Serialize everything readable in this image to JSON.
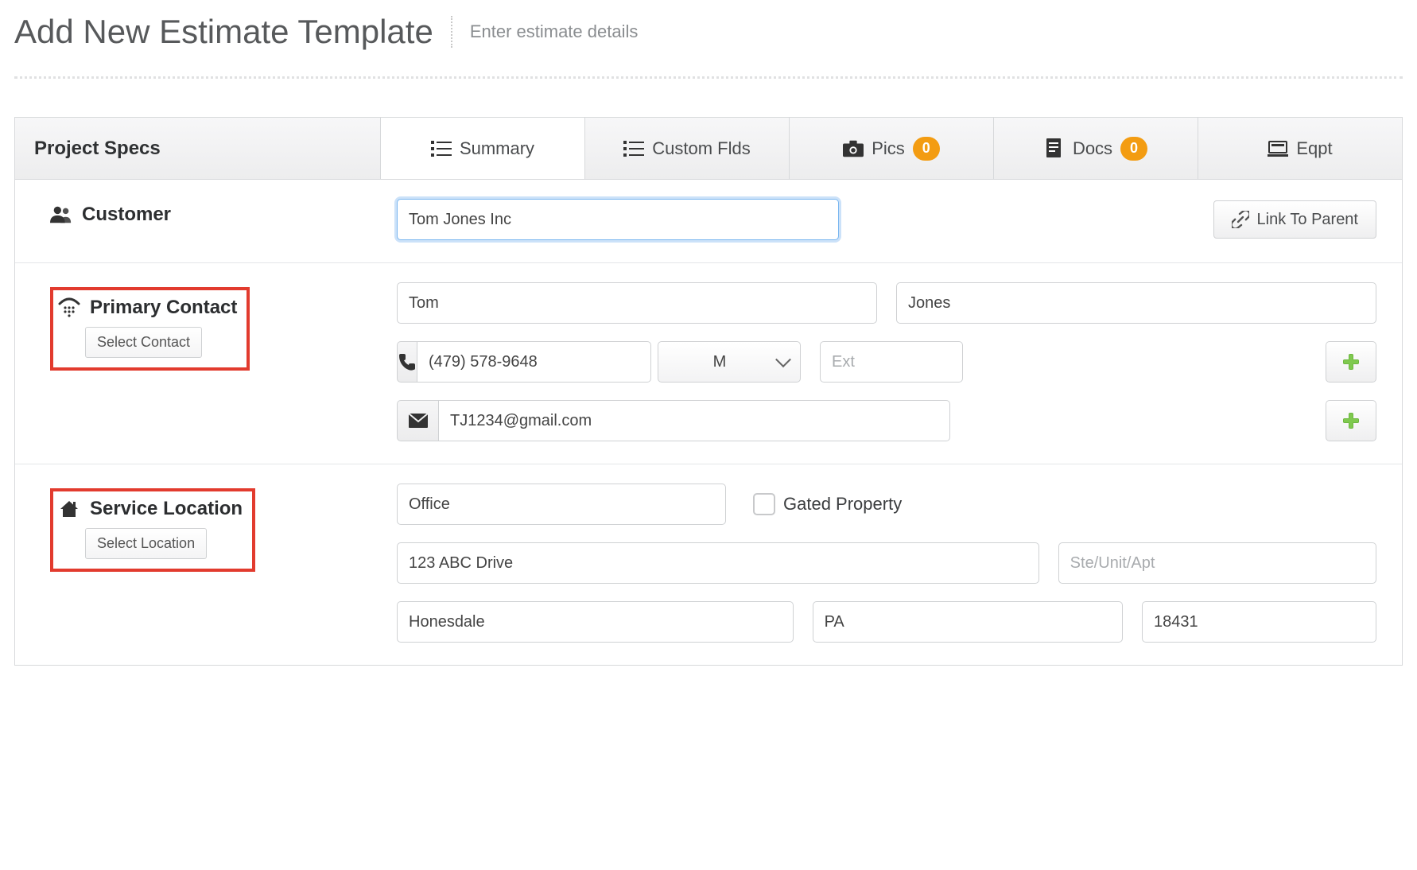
{
  "header": {
    "title": "Add New Estimate Template",
    "subtitle": "Enter estimate details"
  },
  "panel": {
    "section_title": "Project Specs",
    "tabs": {
      "summary": "Summary",
      "custom_flds": "Custom Flds",
      "pics": "Pics",
      "pics_count": "0",
      "docs": "Docs",
      "docs_count": "0",
      "eqpt": "Eqpt"
    }
  },
  "customer": {
    "label": "Customer",
    "value": "Tom Jones Inc",
    "link_parent": "Link To Parent"
  },
  "primary_contact": {
    "label": "Primary Contact",
    "select_btn": "Select Contact",
    "first_name": "Tom",
    "last_name": "Jones",
    "phone": "(479) 578-9648",
    "phone_type": "M",
    "ext_placeholder": "Ext",
    "email": "TJ1234@gmail.com"
  },
  "service_location": {
    "label": "Service Location",
    "select_btn": "Select Location",
    "name": "Office",
    "gated_label": "Gated Property",
    "gated_checked": false,
    "address1": "123 ABC Drive",
    "address2_placeholder": "Ste/Unit/Apt",
    "city": "Honesdale",
    "state": "PA",
    "zip": "18431"
  }
}
